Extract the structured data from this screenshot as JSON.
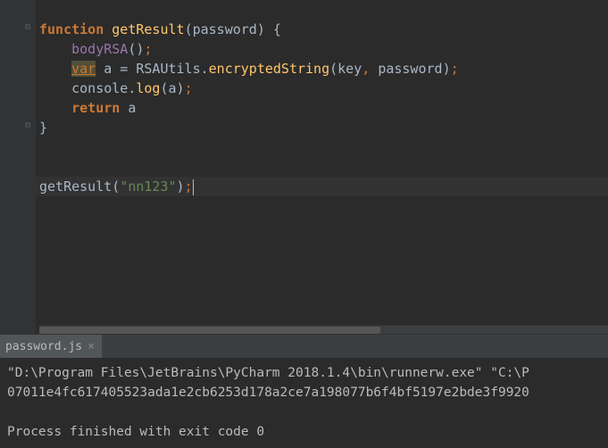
{
  "code": {
    "l1": {
      "kw": "function",
      "name": "getResult",
      "lp": "(",
      "param": "password",
      "rp": ")",
      "brace": " {"
    },
    "l2": {
      "indent": "    ",
      "call": "bodyRSA",
      "parens": "()",
      "semi": ";"
    },
    "l3": {
      "indent": "    ",
      "varkw": "var",
      "sp": " ",
      "a": "a",
      "eq": " = ",
      "obj": "RSAUtils",
      "dot": ".",
      "method": "encryptedString",
      "lp": "(",
      "arg1": "key",
      "comma": ",",
      "sp2": " ",
      "arg2": "password",
      "rp": ")",
      "semi": ";"
    },
    "l4": {
      "indent": "    ",
      "console": "console",
      "dot": ".",
      "log": "log",
      "lp": "(",
      "a": "a",
      "rp": ")",
      "semi": ";"
    },
    "l5": {
      "indent": "    ",
      "ret": "return",
      "sp": " ",
      "a": "a"
    },
    "l6": {
      "brace": "}"
    },
    "l7": {
      "call": "getResult",
      "lp": "(",
      "str": "\"nn123\"",
      "rp": ")",
      "semi": ";"
    }
  },
  "console": {
    "tab": "password.js",
    "line1": "\"D:\\Program Files\\JetBrains\\PyCharm 2018.1.4\\bin\\runnerw.exe\" \"C:\\P",
    "line2": "07011e4fc617405523ada1e2cb6253d178a2ce7a198077b6f4bf5197e2bde3f9920",
    "line3": "",
    "line4": "Process finished with exit code 0"
  }
}
